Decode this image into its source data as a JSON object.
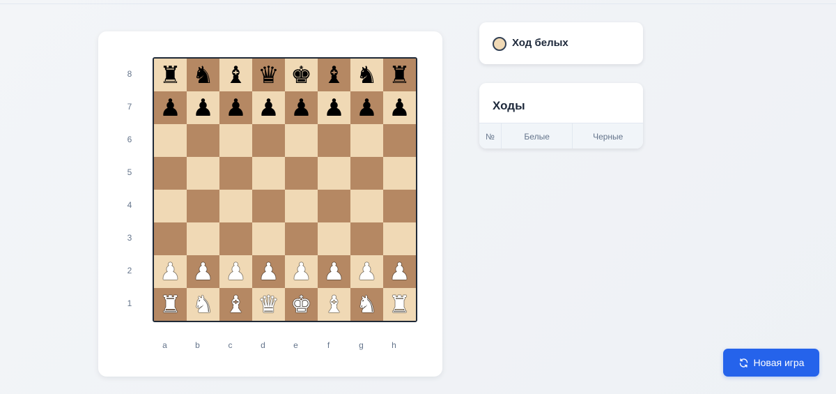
{
  "board": {
    "files": [
      "a",
      "b",
      "c",
      "d",
      "e",
      "f",
      "g",
      "h"
    ],
    "ranks": [
      "8",
      "7",
      "6",
      "5",
      "4",
      "3",
      "2",
      "1"
    ],
    "position": [
      [
        "bR",
        "bN",
        "bB",
        "bQ",
        "bK",
        "bB",
        "bN",
        "bR"
      ],
      [
        "bP",
        "bP",
        "bP",
        "bP",
        "bP",
        "bP",
        "bP",
        "bP"
      ],
      [
        "",
        "",
        "",
        "",
        "",
        "",
        "",
        ""
      ],
      [
        "",
        "",
        "",
        "",
        "",
        "",
        "",
        ""
      ],
      [
        "",
        "",
        "",
        "",
        "",
        "",
        "",
        ""
      ],
      [
        "",
        "",
        "",
        "",
        "",
        "",
        "",
        ""
      ],
      [
        "wP",
        "wP",
        "wP",
        "wP",
        "wP",
        "wP",
        "wP",
        "wP"
      ],
      [
        "wR",
        "wN",
        "wB",
        "wQ",
        "wK",
        "wB",
        "wN",
        "wR"
      ]
    ],
    "colors": {
      "light": "#f0d9b5",
      "dark": "#b58863"
    }
  },
  "turn": {
    "label": "Ход белых",
    "side": "white"
  },
  "moves": {
    "title": "Ходы",
    "columns": {
      "number": "№",
      "white": "Белые",
      "black": "Черные"
    },
    "rows": []
  },
  "new_game": {
    "label": "Новая игра",
    "icon": "refresh-icon"
  },
  "accent": "#2563eb"
}
